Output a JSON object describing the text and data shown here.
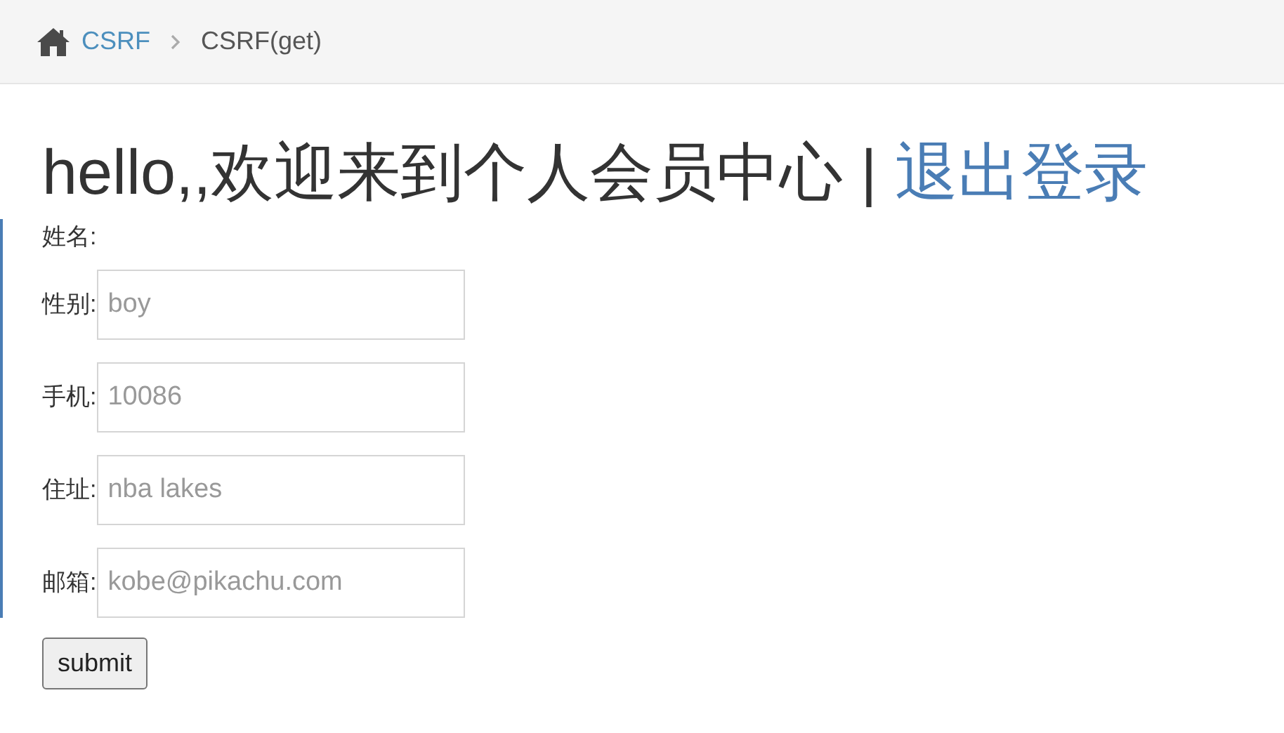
{
  "breadcrumb": {
    "items": [
      {
        "label": "CSRF",
        "kind": "link"
      },
      {
        "label": "CSRF(get)",
        "kind": "current"
      }
    ]
  },
  "heading": {
    "text": "hello,,欢迎来到个人会员中心",
    "separator": "|",
    "link": "退出登录"
  },
  "form": {
    "fields": [
      {
        "label": "姓名:",
        "kind": "text"
      },
      {
        "label": "性别:",
        "kind": "input",
        "placeholder": "boy"
      },
      {
        "label": "手机:",
        "kind": "input",
        "placeholder": "10086"
      },
      {
        "label": "住址:",
        "kind": "input",
        "placeholder": "nba lakes"
      },
      {
        "label": "邮箱:",
        "kind": "input",
        "placeholder": "kobe@pikachu.com"
      }
    ],
    "submit": "submit"
  }
}
